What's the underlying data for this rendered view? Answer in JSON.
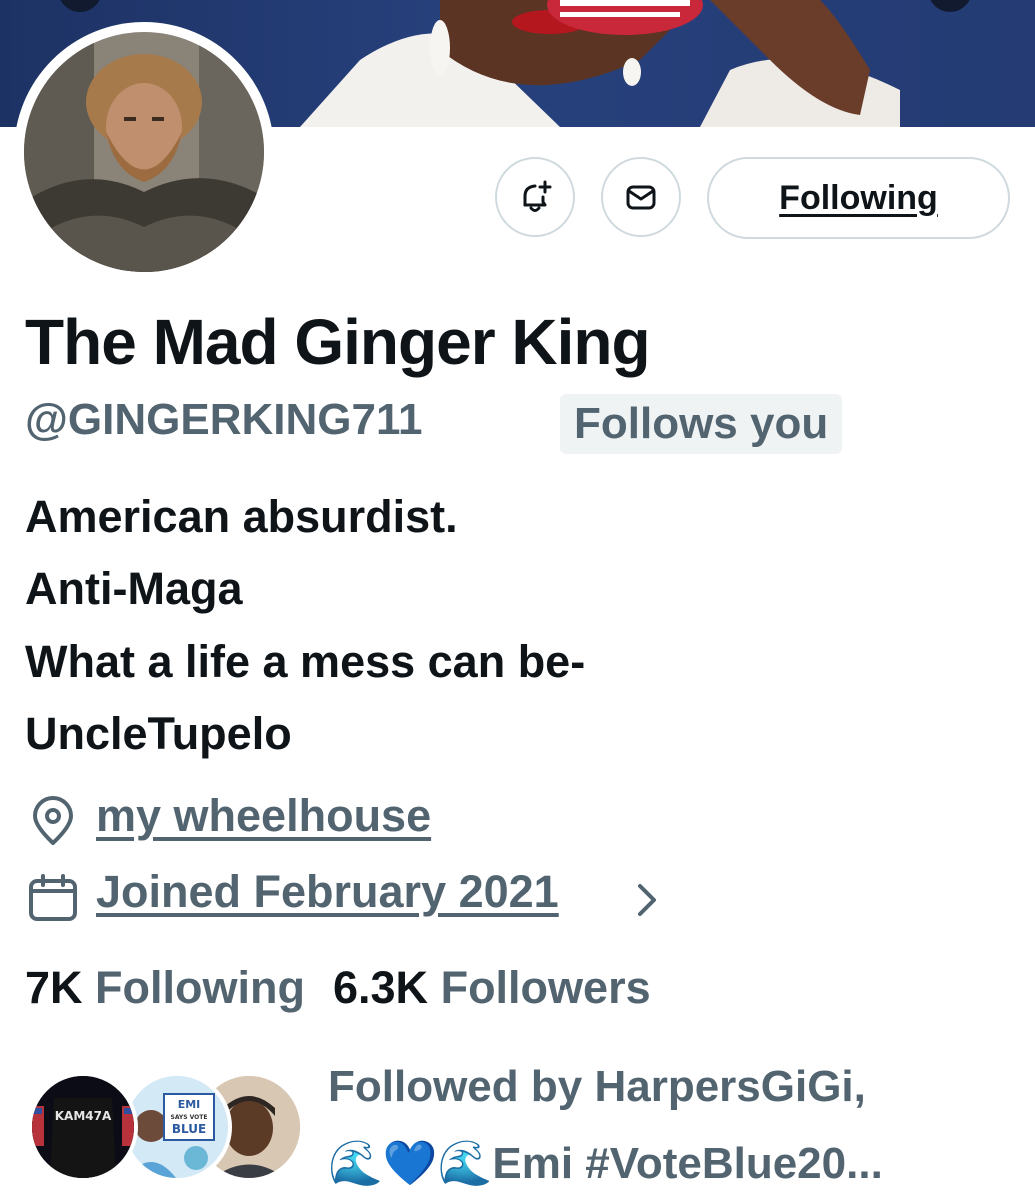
{
  "profile": {
    "display_name": "The Mad Ginger King",
    "handle": "@GINGERKING711",
    "follows_you_badge": "Follows you"
  },
  "actions": {
    "notify_icon": "bell-plus-icon",
    "message_icon": "envelope-icon",
    "following_label": "Following"
  },
  "bio": {
    "lines": [
      "American absurdist.",
      "Anti-Maga",
      "What a life a mess can be-",
      "UncleTupelo"
    ]
  },
  "meta": {
    "location": "my wheelhouse",
    "location_icon": "location-pin-icon",
    "joined": "Joined February 2021",
    "joined_icon": "calendar-icon",
    "joined_chevron_icon": "chevron-right-icon"
  },
  "stats": {
    "following_count": "7K",
    "following_label": "Following",
    "followers_count": "6.3K",
    "followers_label": "Followers"
  },
  "followed_by": {
    "line1": "Followed by HarpersGiGi,",
    "line2": "🌊💙🌊Emi #VoteBlue20...",
    "avatar1_text": "KAM47A",
    "avatar2_text_top": "EMI",
    "avatar2_text_mid": "SAYS VOTE",
    "avatar2_text_bottom": "BLUE"
  },
  "colors": {
    "primary_text": "#0f1419",
    "secondary_text": "#536471",
    "border": "#cfd9de",
    "badge_bg": "#eff3f4",
    "banner_blue": "#243b73"
  }
}
